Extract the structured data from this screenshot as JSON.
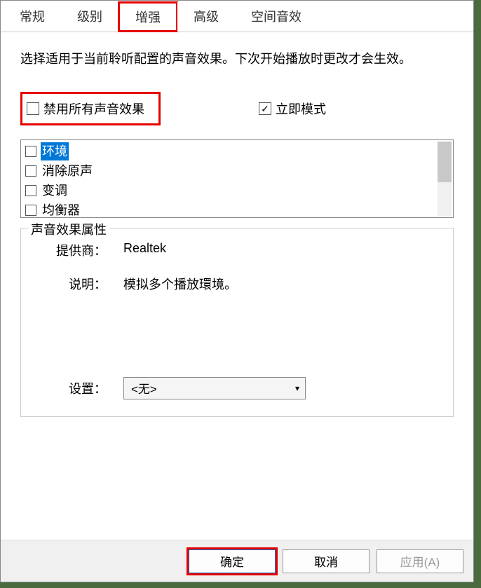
{
  "tabs": {
    "general": "常规",
    "levels": "级别",
    "enhance": "增强",
    "advanced": "高级",
    "spatial": "空间音效"
  },
  "description": "选择适用于当前聆听配置的声音效果。下次开始播放时更改才会生效。",
  "checkboxes": {
    "disable_all": {
      "label": "禁用所有声音效果",
      "checked": false
    },
    "immediate": {
      "label": "立即模式",
      "checked": true
    }
  },
  "effects": [
    {
      "label": "环境",
      "checked": false,
      "selected": true
    },
    {
      "label": "消除原声",
      "checked": false,
      "selected": false
    },
    {
      "label": "变调",
      "checked": false,
      "selected": false
    },
    {
      "label": "均衡器",
      "checked": false,
      "selected": false
    }
  ],
  "properties": {
    "title": "声音效果属性",
    "provider_label": "提供商：",
    "provider_value": "Realtek",
    "desc_label": "说明：",
    "desc_value": "模拟多个播放環境。",
    "settings_label": "设置：",
    "settings_value": "<无>"
  },
  "buttons": {
    "ok": "确定",
    "cancel": "取消",
    "apply": "应用(A)"
  }
}
